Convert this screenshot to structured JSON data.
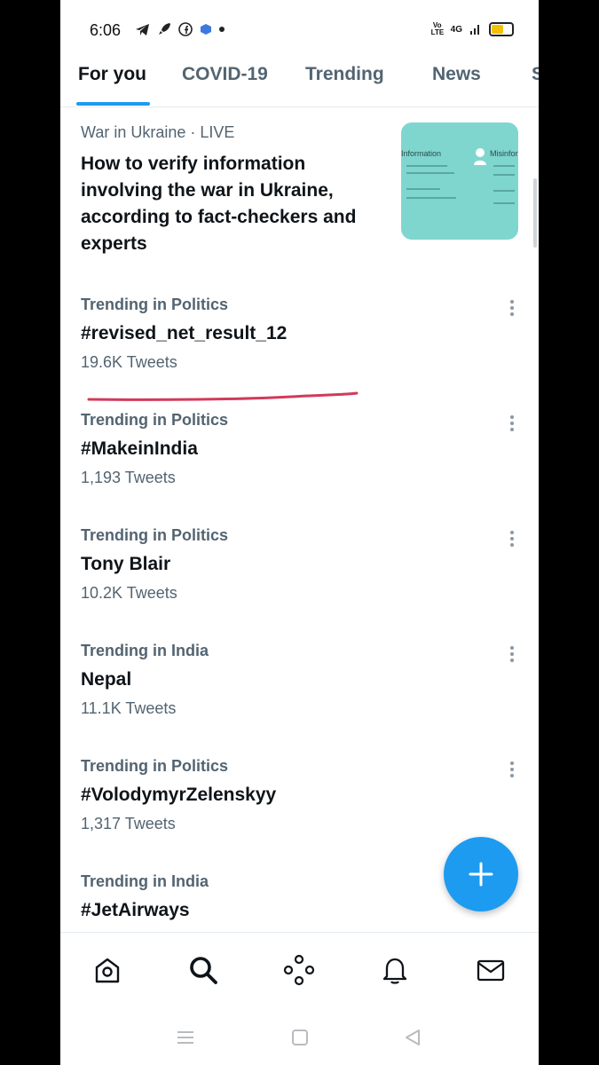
{
  "status_bar": {
    "time": "6:06",
    "volte_label": "Vo LTE",
    "network_label": "4G"
  },
  "tabs": [
    {
      "label": "For you"
    },
    {
      "label": "COVID-19"
    },
    {
      "label": "Trending"
    },
    {
      "label": "News"
    },
    {
      "label": "S"
    }
  ],
  "news": {
    "topic": "War in Ukraine",
    "separator": " · ",
    "status": "LIVE",
    "title": "How to verify information involving the war in Ukraine, according to fact-checkers and experts",
    "thumbnail_left": "Information",
    "thumbnail_right": "Misinfor"
  },
  "trends": [
    {
      "context": "Trending in Politics",
      "name": "#revised_net_result_12",
      "count": "19.6K Tweets"
    },
    {
      "context": "Trending in Politics",
      "name": "#MakeinIndia",
      "count": "1,193 Tweets"
    },
    {
      "context": "Trending in Politics",
      "name": "Tony Blair",
      "count": "10.2K Tweets"
    },
    {
      "context": "Trending in India",
      "name": "Nepal",
      "count": "11.1K Tweets"
    },
    {
      "context": "Trending in Politics",
      "name": "#VolodymyrZelenskyy",
      "count": "1,317 Tweets"
    },
    {
      "context": "Trending in India",
      "name": "#JetAirways",
      "count": ""
    }
  ],
  "colors": {
    "accent": "#1d9bf0",
    "annotation_line": "#d23a5a",
    "thumbnail_bg": "#7fd6cf"
  },
  "bottom_nav": [
    "home-icon",
    "search-icon",
    "spaces-icon",
    "bell-icon",
    "mail-icon"
  ],
  "system_nav": [
    "menu-icon",
    "home-square-icon",
    "back-icon"
  ]
}
